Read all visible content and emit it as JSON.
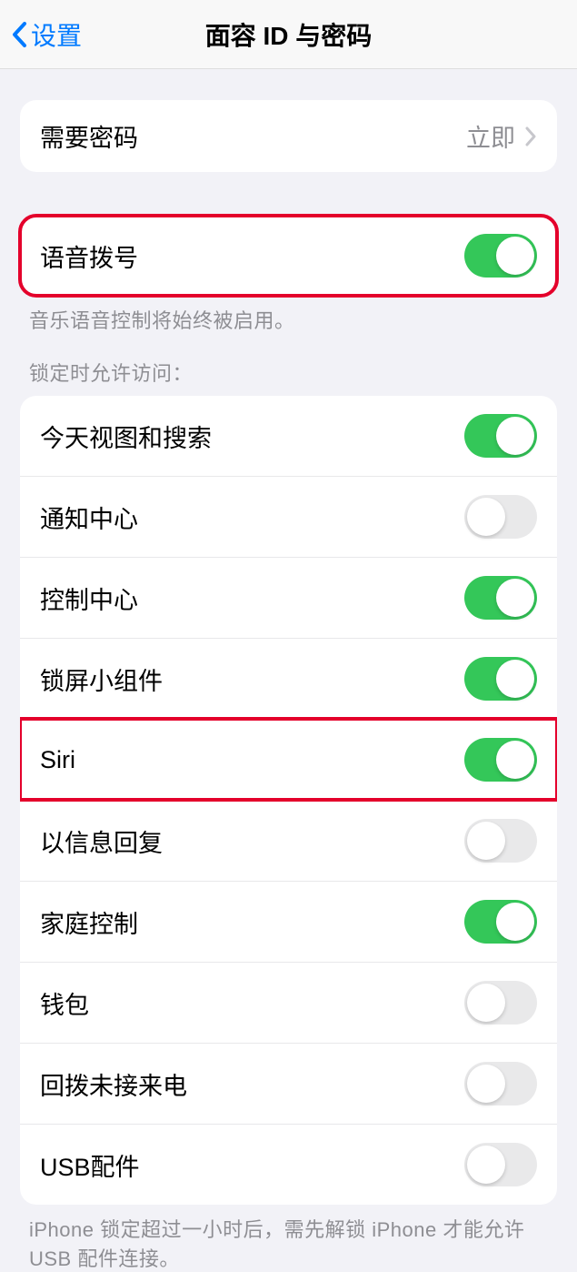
{
  "nav": {
    "back": "设置",
    "title": "面容 ID 与密码"
  },
  "passcode_group": {
    "require_passcode": {
      "label": "需要密码",
      "value": "立即"
    }
  },
  "voice_dial": {
    "label": "语音拨号",
    "on": true,
    "footer": "音乐语音控制将始终被启用。"
  },
  "lock_access": {
    "header": "锁定时允许访问：",
    "items": [
      {
        "label": "今天视图和搜索",
        "on": true
      },
      {
        "label": "通知中心",
        "on": false
      },
      {
        "label": "控制中心",
        "on": true
      },
      {
        "label": "锁屏小组件",
        "on": true
      },
      {
        "label": "Siri",
        "on": true,
        "highlight": true
      },
      {
        "label": "以信息回复",
        "on": false
      },
      {
        "label": "家庭控制",
        "on": true
      },
      {
        "label": "钱包",
        "on": false
      },
      {
        "label": "回拨未接来电",
        "on": false
      },
      {
        "label": "USB配件",
        "on": false
      }
    ],
    "footer": "iPhone 锁定超过一小时后，需先解锁 iPhone 才能允许 USB 配件连接。"
  }
}
